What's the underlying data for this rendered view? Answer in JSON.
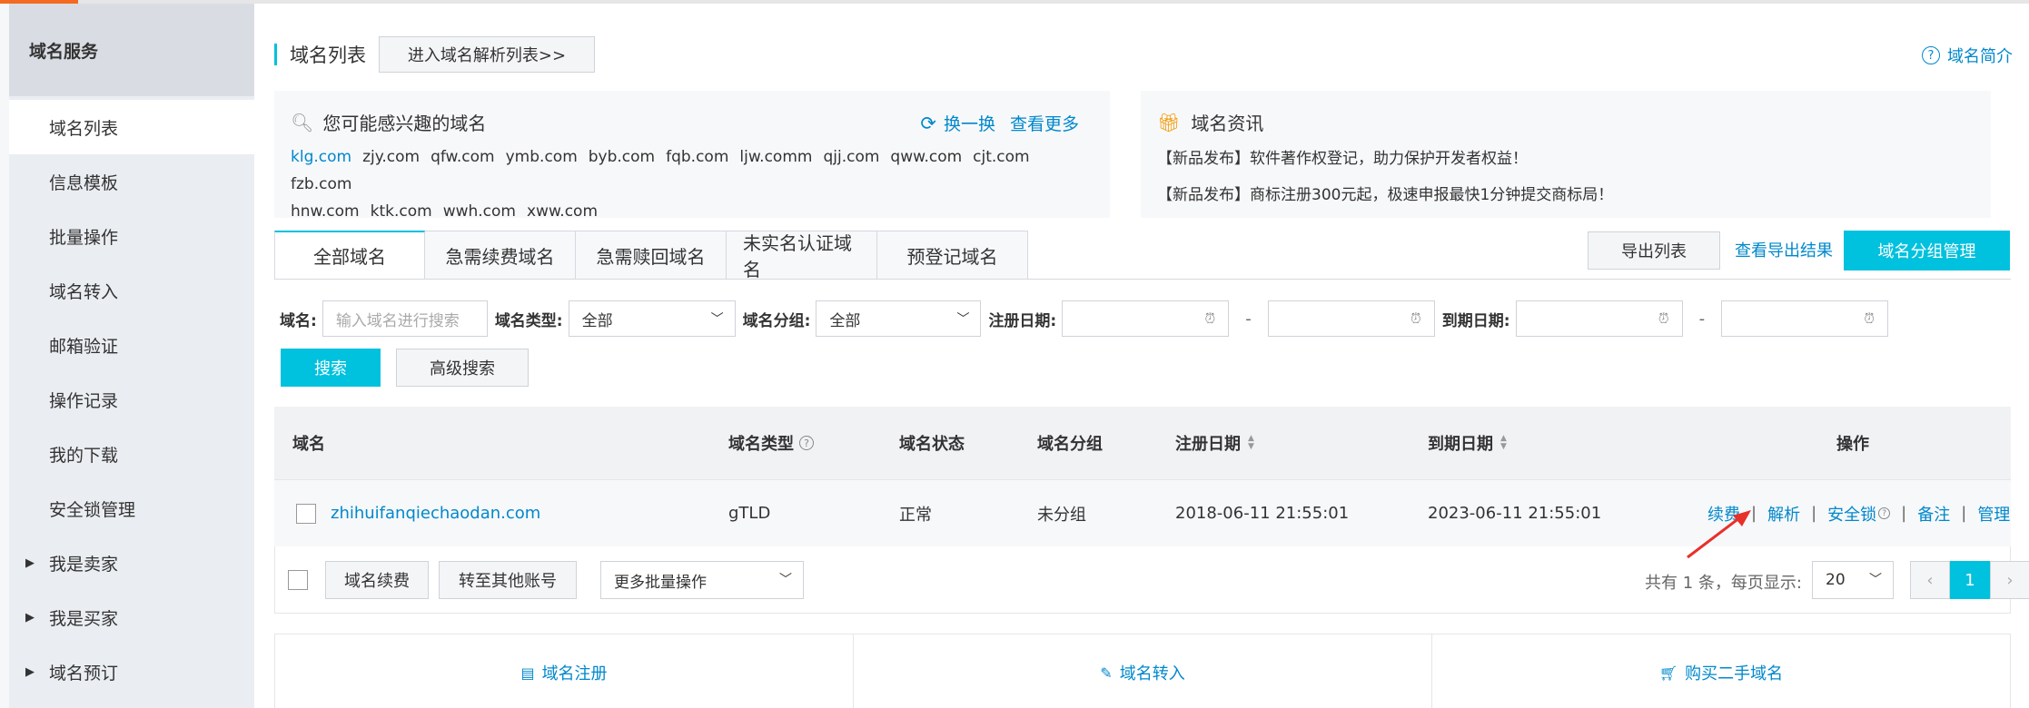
{
  "sidebar": {
    "header": "域名服务",
    "items": [
      {
        "label": "域名列表",
        "active": true
      },
      {
        "label": "信息模板"
      },
      {
        "label": "批量操作"
      },
      {
        "label": "域名转入"
      },
      {
        "label": "邮箱验证"
      },
      {
        "label": "操作记录"
      },
      {
        "label": "我的下载"
      },
      {
        "label": "安全锁管理"
      },
      {
        "label": "我是卖家",
        "collapsible": true
      },
      {
        "label": "我是买家",
        "collapsible": true
      },
      {
        "label": "域名预订",
        "collapsible": true
      }
    ]
  },
  "header": {
    "title": "域名列表",
    "enter_button": "进入域名解析列表>>",
    "intro_link": "域名简介"
  },
  "interest": {
    "title": "您可能感兴趣的域名",
    "refresh": "换一换",
    "more": "查看更多",
    "domains": [
      "klg.com",
      "zjy.com",
      "qfw.com",
      "ymb.com",
      "byb.com",
      "fqb.com",
      "ljw.comm",
      "qjj.com",
      "qww.com",
      "cjt.com",
      "fzb.com",
      "hnw.com",
      "ktk.com",
      "wwh.com",
      "xww.com"
    ]
  },
  "news": {
    "title": "域名资讯",
    "items": [
      "【新品发布】软件著作权登记，助力保护开发者权益！",
      "【新品发布】商标注册300元起，极速申报最快1分钟提交商标局！"
    ]
  },
  "tabs": [
    "全部域名",
    "急需续费域名",
    "急需赎回域名",
    "未实名认证域名",
    "预登记域名"
  ],
  "toolbar": {
    "export": "导出列表",
    "export_result": "查看导出结果",
    "group_manage": "域名分组管理"
  },
  "filter": {
    "domain_label": "域名:",
    "domain_placeholder": "输入域名进行搜索",
    "type_label": "域名类型:",
    "type_value": "全部",
    "group_label": "域名分组:",
    "group_value": "全部",
    "reg_label": "注册日期:",
    "exp_label": "到期日期:",
    "dash": "-",
    "search": "搜索",
    "advanced": "高级搜索"
  },
  "table": {
    "columns": {
      "domain": "域名",
      "type": "域名类型",
      "status": "域名状态",
      "group": "域名分组",
      "reg_date": "注册日期",
      "exp_date": "到期日期",
      "ops": "操作"
    },
    "rows": [
      {
        "domain": "zhihuifanqiechaodan.com",
        "type": "gTLD",
        "status": "正常",
        "group": "未分组",
        "reg_date": "2018-06-11 21:55:01",
        "exp_date": "2023-06-11 21:55:01",
        "ops": [
          "续费",
          "解析",
          "安全锁",
          "备注",
          "管理"
        ]
      }
    ],
    "sep": "|"
  },
  "footer": {
    "renew": "域名续费",
    "transfer": "转至其他账号",
    "more_batch": "更多批量操作",
    "pager_text": "共有 1 条，每页显示:",
    "page_size": "20",
    "prev": "‹",
    "current_page": "1",
    "next": "›"
  },
  "quick": [
    "域名注册",
    "域名转入",
    "购买二手域名"
  ],
  "colors": {
    "accent": "#00c1de",
    "link": "#0088cc",
    "top_accent": "#f36a21",
    "annotation": "#e8302a"
  }
}
